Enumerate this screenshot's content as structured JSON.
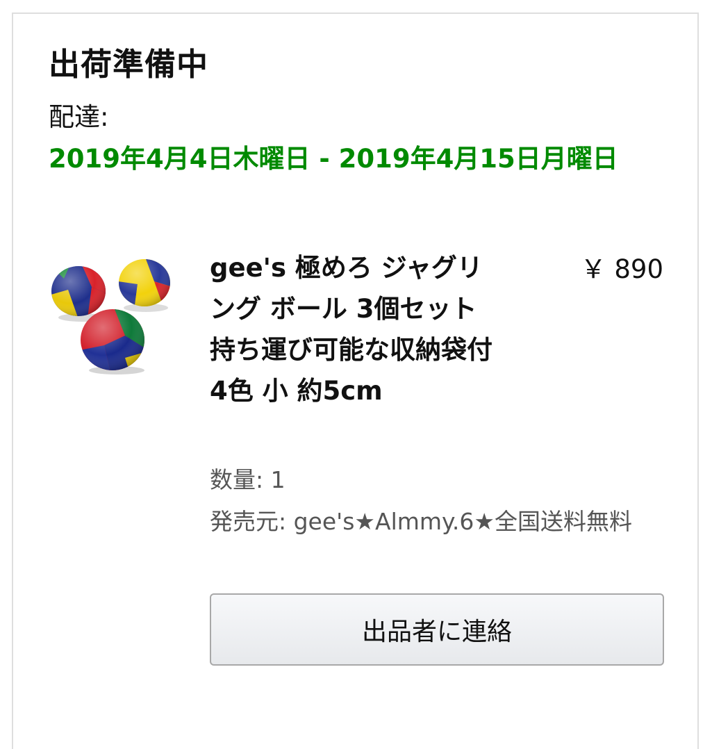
{
  "order": {
    "status": "出荷準備中",
    "delivery_label": "配達:",
    "delivery_dates": "2019年4月4日木曜日 - 2019年4月15日月曜日"
  },
  "item": {
    "title": "gee's 極めろ ジャグリング ボール 3個セット持ち運び可能な収納袋付 4色 小 約5cm",
    "price": "￥ 890",
    "quantity": "数量: 1",
    "seller": "発売元: gee's★Almmy.6★全国送料無料",
    "image_icon": "juggling-balls-image"
  },
  "actions": {
    "contact_seller": "出品者に連絡"
  },
  "colors": {
    "delivery_green": "#008a00",
    "button_border": "#a8a8a8"
  }
}
